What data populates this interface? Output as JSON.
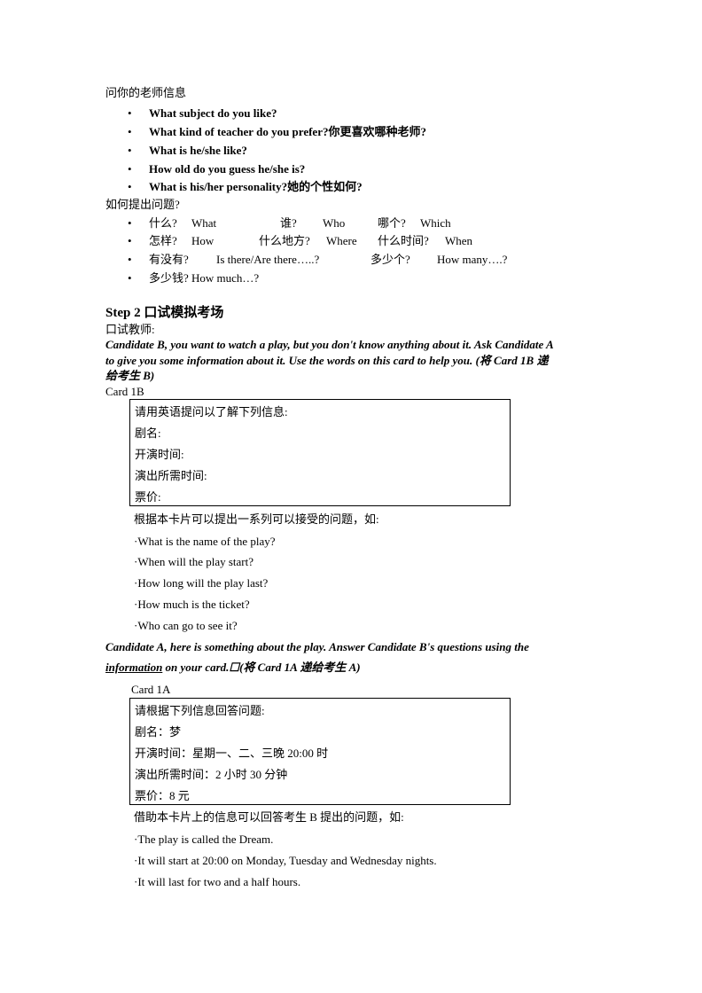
{
  "section1": {
    "heading": "问你的老师信息",
    "questions": [
      "What subject do you like?",
      "What kind of teacher do you prefer?你更喜欢哪种老师?",
      "What is he/she like?",
      "How old do you guess he/she is?",
      "What is his/her personality?她的个性如何?"
    ]
  },
  "section2": {
    "heading": "如何提出问题?",
    "rows": [
      [
        "什么?",
        "What",
        "谁?",
        "Who",
        "哪个?",
        "Which"
      ],
      [
        "怎样?",
        "How",
        "什么地方?",
        "Where",
        "什么时间?",
        "When"
      ],
      [
        "有没有?",
        "Is there/Are there…..?",
        "多少个?",
        "How many….?"
      ],
      [
        "多少钱? How much…?"
      ]
    ]
  },
  "step2": {
    "title": "Step 2  口试模拟考场",
    "examiner": "口试教师:",
    "instruction_b": [
      "Candidate B, you want to watch a play, but you don't know anything about it. Ask Candidate A",
      "to give you some information about it. Use the words on this card to help you. (将 Card 1B  递",
      "给考生 B)"
    ],
    "card_b_label": "Card 1B",
    "card_b_lines": [
      "请用英语提问以了解下列信息:",
      "剧名:",
      "开演时间:",
      "演出所需时间:",
      "票价:"
    ],
    "card_b_intro": "根据本卡片可以提出一系列可以接受的问题，如:",
    "card_b_examples": [
      "·What is the name of the play?",
      "·When will the play start?",
      "·How long will the play last?",
      "·How much is the ticket?",
      "·Who can go to see it?"
    ],
    "instruction_a_line1": "Candidate A, here is something about the play. Answer Candidate B's questions using the",
    "instruction_a_underlined": "information",
    "instruction_a_rest": " on your card.☐(将 Card 1A 递给考生 A)",
    "card_a_label": "Card 1A",
    "card_a_lines": [
      "请根据下列信息回答问题:",
      "剧名：梦",
      "开演时间：星期一、二、三晚 20:00 时",
      "演出所需时间：2 小时 30 分钟",
      "票价：8 元"
    ],
    "card_a_intro": "借助本卡片上的信息可以回答考生 B 提出的问题，如:",
    "card_a_examples": [
      "·The play is called the Dream.",
      "·It will start at 20:00 on Monday, Tuesday and Wednesday nights.",
      "·It will last for two and a half hours."
    ]
  }
}
